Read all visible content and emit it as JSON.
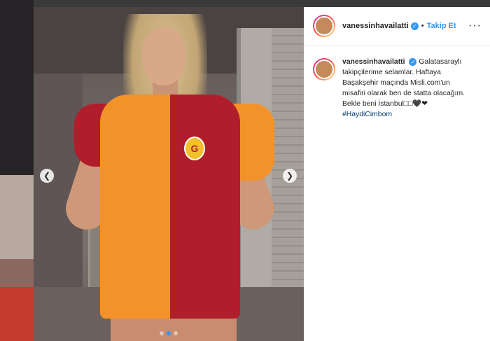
{
  "post": {
    "username": "vanessinhavailatti",
    "follow_label": "Takip Et",
    "separator": "•",
    "more_label": "···",
    "caption_lines": [
      "Galatasaraylı",
      "takipçilerime selamlar. Haftaya",
      "Başakşehir maçında Misli.com'un",
      "misafiri olarak ben de statta olacağım.",
      "Bekle beni İstanbul□□🖤❤"
    ],
    "hashtag": "#HaydiCimbom"
  },
  "carousel": {
    "prev_icon": "chevron-left-icon",
    "next_icon": "chevron-right-icon",
    "slide_count": 3,
    "active_slide": 2
  },
  "colors": {
    "accent": "#3897f0",
    "hashtag": "#00376b",
    "jersey_orange": "#f2932a",
    "jersey_red": "#b11e2b"
  }
}
